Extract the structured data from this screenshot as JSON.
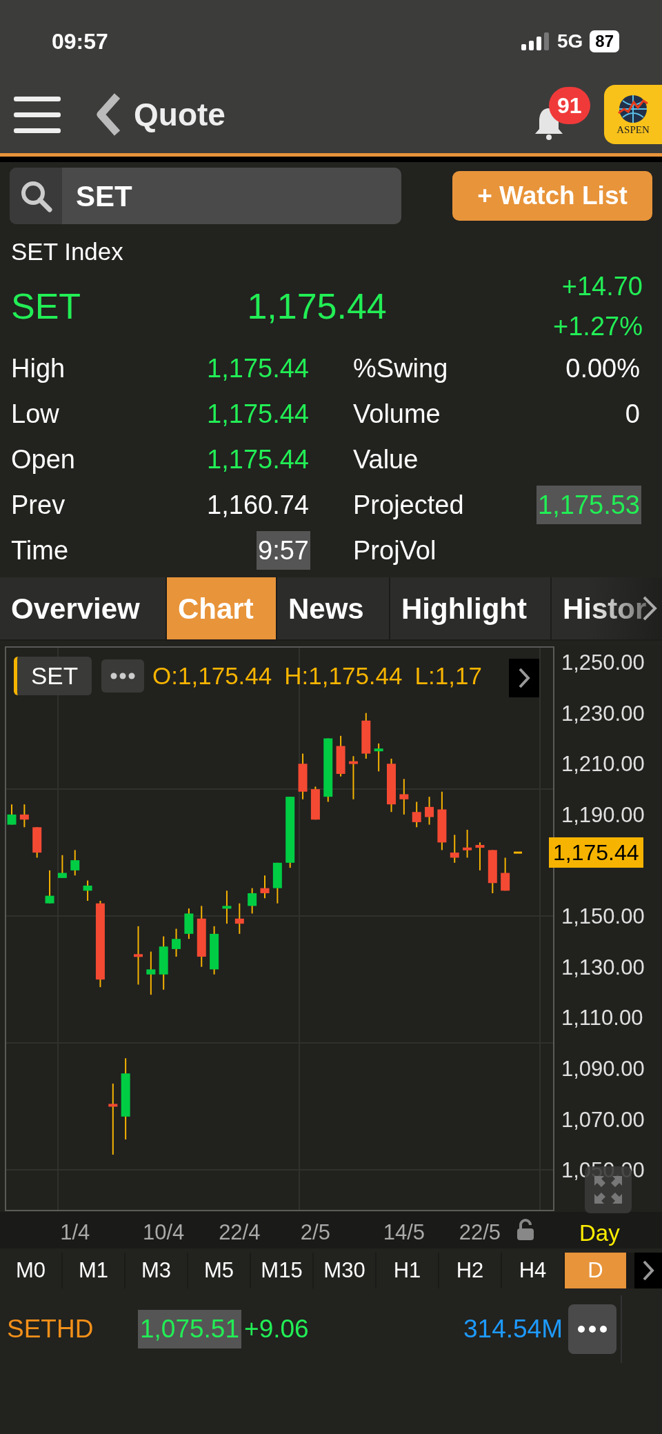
{
  "status_bar": {
    "time": "09:57",
    "network": "5G",
    "battery": "87"
  },
  "header": {
    "title": "Quote",
    "notification_count": "91",
    "logo_text": "ASPEN"
  },
  "search": {
    "value": "SET"
  },
  "watch_button": "+ Watch List",
  "quote": {
    "name": "SET Index",
    "symbol": "SET",
    "last": "1,175.44",
    "change": "+14.70",
    "change_pct": "+1.27%"
  },
  "stats_left": [
    {
      "label": "High",
      "value": "1,175.44",
      "up": true,
      "highlight": false
    },
    {
      "label": "Low",
      "value": "1,175.44",
      "up": true,
      "highlight": false
    },
    {
      "label": "Open",
      "value": "1,175.44",
      "up": true,
      "highlight": false
    },
    {
      "label": "Prev",
      "value": "1,160.74",
      "up": false,
      "highlight": false
    },
    {
      "label": "Time",
      "value": "9:57",
      "up": false,
      "highlight": true
    }
  ],
  "stats_right": [
    {
      "label": "%Swing",
      "value": "0.00%",
      "up": false,
      "highlight": false
    },
    {
      "label": "Volume",
      "value": "0",
      "up": false,
      "highlight": false
    },
    {
      "label": "Value"
    },
    {
      "label": "Projected",
      "value": "1,175.53",
      "up": true,
      "highlight": true
    },
    {
      "label": "ProjVol"
    }
  ],
  "tabs": [
    {
      "label": "Overview",
      "selected": false
    },
    {
      "label": "Chart",
      "selected": true
    },
    {
      "label": "News",
      "selected": false
    },
    {
      "label": "Highlight",
      "selected": false
    },
    {
      "label": "Histor",
      "selected": false
    }
  ],
  "chart": {
    "symbol": "SET",
    "open_text": "O:1,175.44",
    "high_text": "H:1,175.44",
    "low_text": "L:1,17",
    "price_tag": "1,175.44",
    "range": "Day",
    "chart_data": {
      "type": "candlestick",
      "ylim": [
        1034,
        1256
      ],
      "yticks": [
        {
          "value": 1250,
          "label": "1,250.00"
        },
        {
          "value": 1230,
          "label": "1,230.00"
        },
        {
          "value": 1210,
          "label": "1,210.00"
        },
        {
          "value": 1190,
          "label": "1,190.00"
        },
        {
          "value": 1150,
          "label": "1,150.00"
        },
        {
          "value": 1130,
          "label": "1,130.00"
        },
        {
          "value": 1110,
          "label": "1,110.00"
        },
        {
          "value": 1090,
          "label": "1,090.00"
        },
        {
          "value": 1070,
          "label": "1,070.00"
        },
        {
          "value": 1050,
          "label": "1,050.00"
        }
      ],
      "categories": [
        null,
        null,
        null,
        null,
        null,
        "1/4",
        null,
        null,
        null,
        null,
        null,
        null,
        "10/4",
        null,
        null,
        null,
        null,
        null,
        "22/4",
        null,
        null,
        null,
        null,
        null,
        "2/5",
        null,
        null,
        null,
        null,
        null,
        null,
        "14/5",
        null,
        null,
        null,
        null,
        null,
        "22/5",
        null,
        null,
        null
      ],
      "ohlc": [
        [
          1186,
          1194,
          1186,
          1190
        ],
        [
          1190,
          1194,
          1185,
          1188
        ],
        [
          1185,
          1185,
          1173,
          1175
        ],
        [
          1155,
          1168,
          1155,
          1158
        ],
        [
          1165,
          1174,
          1165,
          1167
        ],
        [
          1168,
          1176,
          1166,
          1172
        ],
        [
          1160,
          1164,
          1156,
          1162
        ],
        [
          1155,
          1156,
          1122,
          1125
        ],
        [
          1076,
          1084,
          1056,
          1075
        ],
        [
          1071,
          1094,
          1062,
          1088
        ],
        [
          1135,
          1146,
          1123,
          1134
        ],
        [
          1127,
          1136,
          1119,
          1129
        ],
        [
          1127,
          1142,
          1121,
          1138
        ],
        [
          1137,
          1145,
          1134,
          1141
        ],
        [
          1143,
          1153,
          1141,
          1151
        ],
        [
          1149,
          1154,
          1130,
          1134
        ],
        [
          1129,
          1146,
          1127,
          1143
        ],
        [
          1153,
          1160,
          1147,
          1154
        ],
        [
          1149,
          1155,
          1143,
          1147
        ],
        [
          1154,
          1161,
          1151,
          1159
        ],
        [
          1161,
          1166,
          1157,
          1159
        ],
        [
          1161,
          1171,
          1155,
          1171
        ],
        [
          1171,
          1197,
          1169,
          1197
        ],
        [
          1210,
          1214,
          1196,
          1199
        ],
        [
          1200,
          1201,
          1188,
          1188
        ],
        [
          1197,
          1220,
          1195,
          1220
        ],
        [
          1217,
          1221,
          1205,
          1206
        ],
        [
          1211,
          1213,
          1196,
          1210
        ],
        [
          1227,
          1230,
          1212,
          1214
        ],
        [
          1215,
          1218,
          1207,
          1216
        ],
        [
          1210,
          1212,
          1191,
          1194
        ],
        [
          1198,
          1204,
          1190,
          1196
        ],
        [
          1191,
          1195,
          1185,
          1187
        ],
        [
          1193,
          1197,
          1186,
          1189
        ],
        [
          1192,
          1199,
          1176,
          1179
        ],
        [
          1175,
          1182,
          1171,
          1173
        ],
        [
          1177,
          1184,
          1173,
          1176
        ],
        [
          1178,
          1179,
          1168,
          1177
        ],
        [
          1176,
          1176,
          1159,
          1163
        ],
        [
          1167,
          1173,
          1160,
          1160
        ],
        [
          1175,
          1175,
          1175,
          1175
        ]
      ]
    }
  },
  "timeframes": [
    {
      "label": "M0",
      "selected": false
    },
    {
      "label": "M1",
      "selected": false
    },
    {
      "label": "M3",
      "selected": false
    },
    {
      "label": "M5",
      "selected": false
    },
    {
      "label": "M15",
      "selected": false
    },
    {
      "label": "M30",
      "selected": false
    },
    {
      "label": "H1",
      "selected": false
    },
    {
      "label": "H2",
      "selected": false
    },
    {
      "label": "H4",
      "selected": false
    },
    {
      "label": "D",
      "selected": true
    }
  ],
  "ticker": {
    "symbol": "SETHD",
    "last": "1,075.51",
    "change": "+9.06",
    "value": "314.54M"
  }
}
